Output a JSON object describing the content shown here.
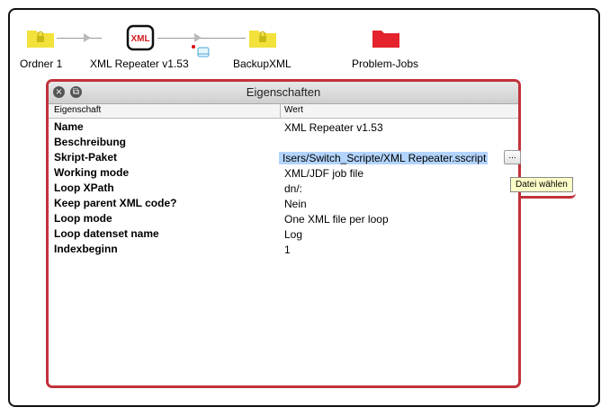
{
  "flow": {
    "nodes": [
      {
        "label": "Ordner 1",
        "icon": "folder-icon",
        "color": "#f3e23b"
      },
      {
        "label": "XML Repeater v1.53",
        "icon": "xml-script-icon",
        "badge": "XML"
      },
      {
        "label": "BackupXML",
        "icon": "folder-icon",
        "color": "#f3e23b"
      },
      {
        "label": "Problem-Jobs",
        "icon": "folder-icon",
        "color": "#e4232c"
      }
    ]
  },
  "panel": {
    "title": "Eigenschaften",
    "col_property": "Eigenschaft",
    "col_value": "Wert",
    "rows": [
      {
        "key": "Name",
        "value": "XML Repeater v1.53"
      },
      {
        "key": "Beschreibung",
        "value": ""
      },
      {
        "key": "Skript-Paket",
        "value": "Isers/Switch_Scripte/XML Repeater.sscript",
        "browse": "..."
      },
      {
        "key": "Working mode",
        "value": "XML/JDF job file"
      },
      {
        "key": "Loop XPath",
        "value": "dn/:"
      },
      {
        "key": "Keep parent XML code?",
        "value": "Nein"
      },
      {
        "key": "Loop mode",
        "value": "One XML file per loop"
      },
      {
        "key": "Loop datenset name",
        "value": "Log"
      },
      {
        "key": "Indexbeginn",
        "value": "1"
      }
    ]
  },
  "tooltip": "Datei wählen",
  "colors": {
    "accent": "#c0323b",
    "folder_yellow": "#f3e23b",
    "folder_red": "#e4232c",
    "selection": "#b3d4fc"
  }
}
